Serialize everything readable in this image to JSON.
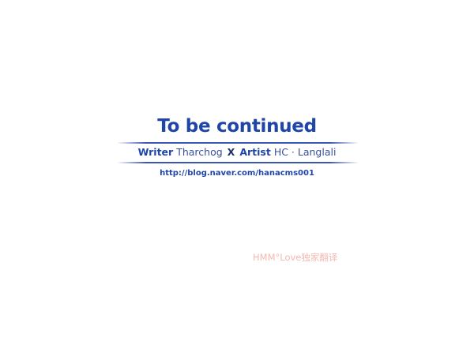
{
  "end_card": {
    "title": "To be continued",
    "credits": {
      "writer_role": "Writer",
      "writer_name": "Tharchog",
      "separator": "X",
      "artist_role": "Artist",
      "artist_name": "HC · Langlali"
    },
    "url": "http://blog.naver.com/hanacms001"
  },
  "watermark": {
    "text": "HMM°Love独家翻译"
  },
  "colors": {
    "title_blue": "#1f45a8",
    "rule_blue": "#3a56b6",
    "watermark_pink": "#f3b9b2",
    "background": "#ffffff"
  }
}
